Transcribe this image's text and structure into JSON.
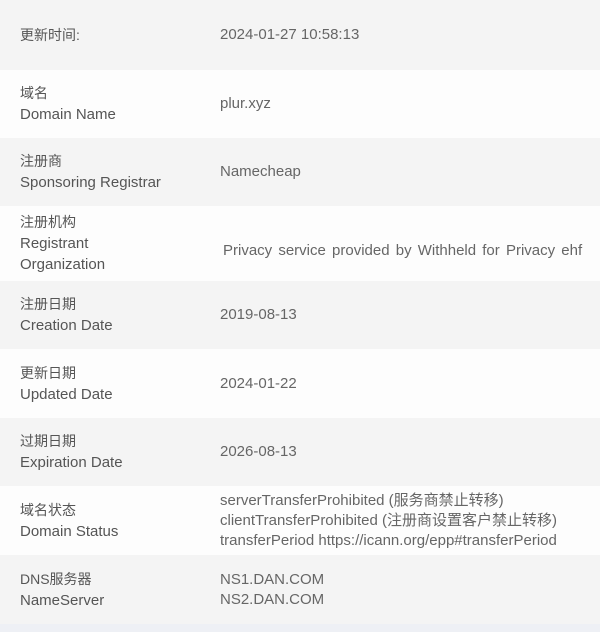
{
  "rows": [
    {
      "zh": "更新时间:",
      "en": "",
      "values": [
        "2024-01-27 10:58:13"
      ]
    },
    {
      "zh": "域名",
      "en": "Domain Name",
      "values": [
        "plur.xyz"
      ]
    },
    {
      "zh": "注册商",
      "en": "Sponsoring Registrar",
      "values": [
        "Namecheap"
      ]
    },
    {
      "zh": "注册机构",
      "en": "Registrant Organization",
      "values": [
        "Privacy service provided by Withheld for Privacy ehf"
      ]
    },
    {
      "zh": "注册日期",
      "en": "Creation Date",
      "values": [
        "2019-08-13"
      ]
    },
    {
      "zh": "更新日期",
      "en": "Updated Date",
      "values": [
        "2024-01-22"
      ]
    },
    {
      "zh": "过期日期",
      "en": "Expiration Date",
      "values": [
        "2026-08-13"
      ]
    },
    {
      "zh": "域名状态",
      "en": "Domain Status",
      "values": [
        "serverTransferProhibited (服务商禁止转移)",
        "clientTransferProhibited (注册商设置客户禁止转移)",
        "transferPeriod https://icann.org/epp#transferPeriod"
      ]
    },
    {
      "zh": "DNS服务器",
      "en": "NameServer",
      "values": [
        "NS1.DAN.COM",
        "NS2.DAN.COM"
      ]
    }
  ]
}
